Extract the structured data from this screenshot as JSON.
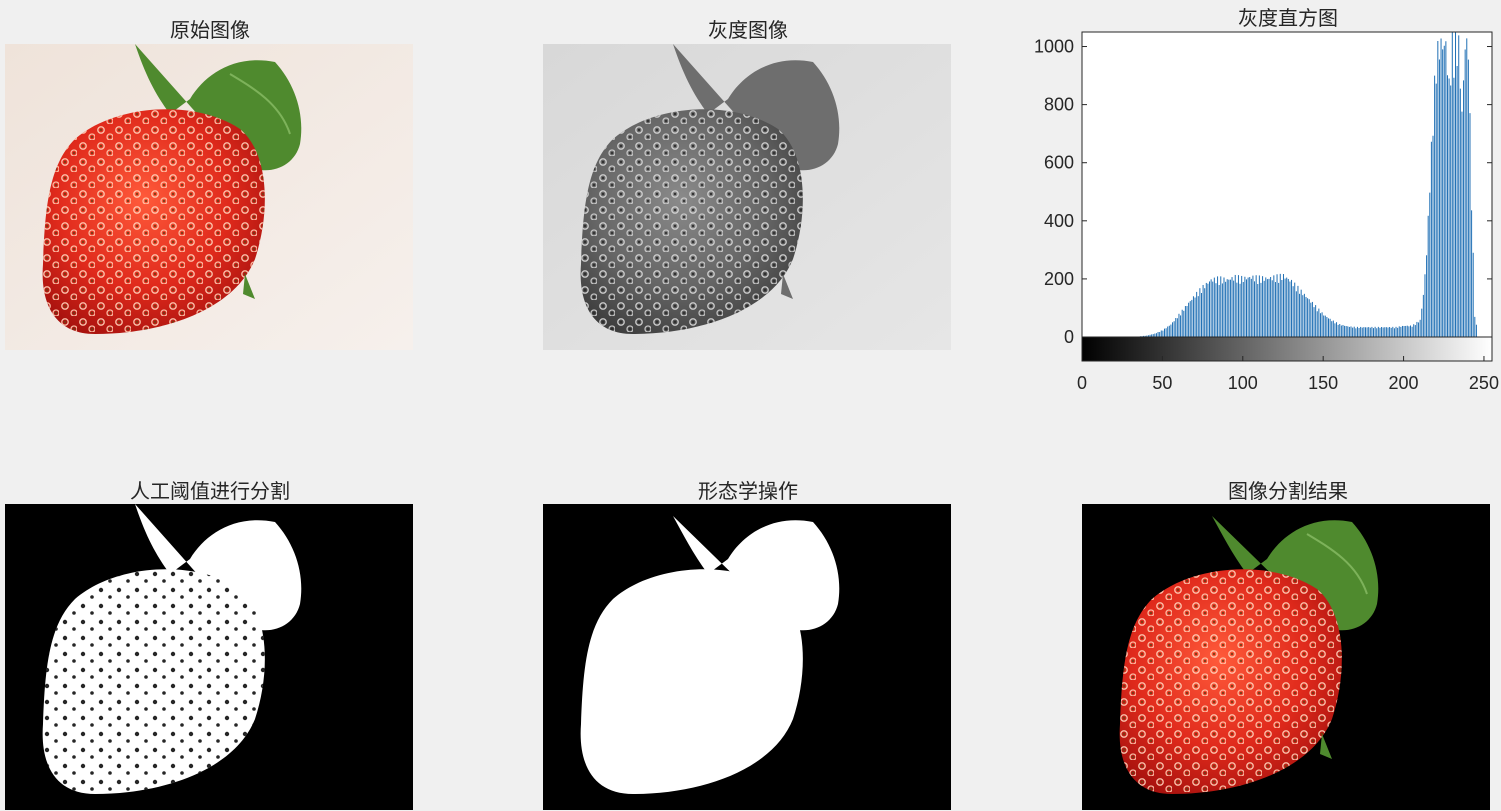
{
  "panels": {
    "original": {
      "title": "原始图像"
    },
    "gray": {
      "title": "灰度图像"
    },
    "histogram": {
      "title": "灰度直方图"
    },
    "manual_threshold": {
      "title": "人工阈值进行分割"
    },
    "morphology": {
      "title": "形态学操作"
    },
    "segmentation": {
      "title": "图像分割结果"
    }
  },
  "colors": {
    "background": "#f0f0f0",
    "bar": "#1f6fb4",
    "strawberry": "#e02a1c",
    "leaf": "#4f8a2e",
    "photo_bg": "#f3ece5",
    "gray_bg": "#dcdcdc"
  },
  "chart_data": {
    "type": "bar",
    "title": "灰度直方图",
    "xlabel": "",
    "ylabel": "",
    "xlim": [
      0,
      255
    ],
    "ylim": [
      0,
      1050
    ],
    "x_ticks": [
      0,
      50,
      100,
      150,
      200,
      250
    ],
    "y_ticks": [
      0,
      200,
      400,
      600,
      800,
      1000
    ],
    "colorbar": "grayscale 0-255",
    "series": [
      {
        "x": [
          30,
          35,
          40,
          45,
          50,
          55,
          60,
          65,
          70,
          75,
          80,
          85,
          90,
          95,
          100,
          105,
          110,
          115,
          120,
          125,
          130,
          135,
          140,
          145,
          150,
          155,
          160,
          165,
          170,
          175,
          180,
          185,
          190,
          195,
          200,
          205,
          210,
          212,
          214,
          216,
          218,
          220,
          222,
          224,
          226,
          228,
          230,
          232,
          234,
          236,
          238,
          240,
          242,
          244,
          246
        ],
        "values": [
          0,
          2,
          5,
          12,
          25,
          45,
          80,
          115,
          150,
          180,
          205,
          210,
          205,
          215,
          210,
          215,
          212,
          210,
          215,
          220,
          200,
          170,
          140,
          110,
          80,
          60,
          45,
          38,
          35,
          35,
          35,
          35,
          35,
          35,
          40,
          40,
          60,
          150,
          300,
          550,
          800,
          1000,
          1050,
          1050,
          1050,
          900,
          1050,
          1050,
          1050,
          800,
          1050,
          1050,
          500,
          80,
          5
        ]
      }
    ]
  }
}
